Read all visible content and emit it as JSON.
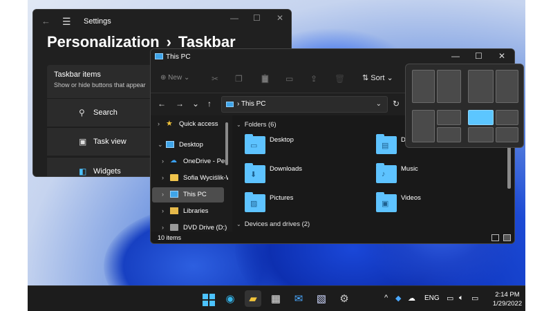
{
  "settings": {
    "back_glyph": "←",
    "menu_glyph": "☰",
    "title": "Settings",
    "controls": {
      "minimize": "—",
      "maximize": "☐",
      "close": "✕"
    },
    "heading": {
      "part1": "Personalization",
      "separator": "›",
      "part2": "Taskbar"
    },
    "card": {
      "title": "Taskbar items",
      "subtitle": "Show or hide buttons that appear"
    },
    "items": [
      {
        "icon": "search-icon",
        "glyph": "⚲",
        "label": "Search"
      },
      {
        "icon": "task-view-icon",
        "glyph": "▣",
        "label": "Task view"
      },
      {
        "icon": "widgets-icon",
        "glyph": "◧",
        "label": "Widgets"
      }
    ]
  },
  "explorer": {
    "title": "This PC",
    "controls": {
      "minimize": "—",
      "maximize": "☐",
      "close": "✕"
    },
    "toolbar": {
      "new_label": "New",
      "new_glyph": "⊕",
      "sort_label": "Sort",
      "sort_glyph": "⇅",
      "icons": [
        {
          "name": "cut-icon",
          "glyph": "✂"
        },
        {
          "name": "copy-icon",
          "glyph": "❐"
        },
        {
          "name": "paste-icon",
          "glyph": "📋"
        },
        {
          "name": "rename-icon",
          "glyph": "▭"
        },
        {
          "name": "share-icon",
          "glyph": "⇪"
        },
        {
          "name": "delete-icon",
          "glyph": "🗑"
        }
      ]
    },
    "address": {
      "back": "←",
      "forward": "→",
      "recent": "⌄",
      "up": "↑",
      "path": "This PC",
      "chevron": "⌄",
      "refresh": "↻"
    },
    "nav": [
      {
        "label": "Quick access",
        "icon": "star",
        "expand": "›"
      },
      {
        "label": "Desktop",
        "icon": "desk",
        "expand": "⌄"
      },
      {
        "label": "OneDrive - Pers",
        "icon": "cloud",
        "expand": "›"
      },
      {
        "label": "Sofia Wyciślik-W",
        "icon": "folder",
        "expand": "›"
      },
      {
        "label": "This PC",
        "icon": "pc",
        "expand": "›",
        "selected": true
      },
      {
        "label": "Libraries",
        "icon": "lib",
        "expand": "›"
      },
      {
        "label": "DVD Drive (D:)",
        "icon": "dvd",
        "expand": "›"
      }
    ],
    "folders_header": "Folders (6)",
    "folders": [
      {
        "label": "Desktop",
        "glyph": "▭"
      },
      {
        "label": "D",
        "glyph": "▤"
      },
      {
        "label": "Downloads",
        "glyph": "⬇"
      },
      {
        "label": "Music",
        "glyph": "♪"
      },
      {
        "label": "Pictures",
        "glyph": "▨"
      },
      {
        "label": "Videos",
        "glyph": "▣"
      }
    ],
    "drives_header": "Devices and drives (2)",
    "collapse_glyph": "⌄",
    "status": "10 items"
  },
  "taskbar": {
    "apps": [
      {
        "name": "start-button",
        "glyph": ""
      },
      {
        "name": "edge-icon",
        "glyph": "◉",
        "color": "#35b3e8"
      },
      {
        "name": "file-explorer-icon",
        "glyph": "▰",
        "color": "#f2c43a",
        "active": true
      },
      {
        "name": "store-icon",
        "glyph": "▦",
        "color": "#e8e8e8"
      },
      {
        "name": "mail-icon",
        "glyph": "✉",
        "color": "#4aa8ff"
      },
      {
        "name": "photo-app-icon",
        "glyph": "▧",
        "color": "#cfd8ff"
      },
      {
        "name": "settings-icon",
        "glyph": "⚙",
        "color": "#c8c8c8"
      }
    ],
    "tray": {
      "chevron": "^",
      "lang": "ENG",
      "time": "2:14 PM",
      "date": "1/29/2022"
    }
  },
  "colors": {
    "accent": "#4cc2ff",
    "window_bg": "#202020",
    "folder": "#5ec3ff"
  }
}
